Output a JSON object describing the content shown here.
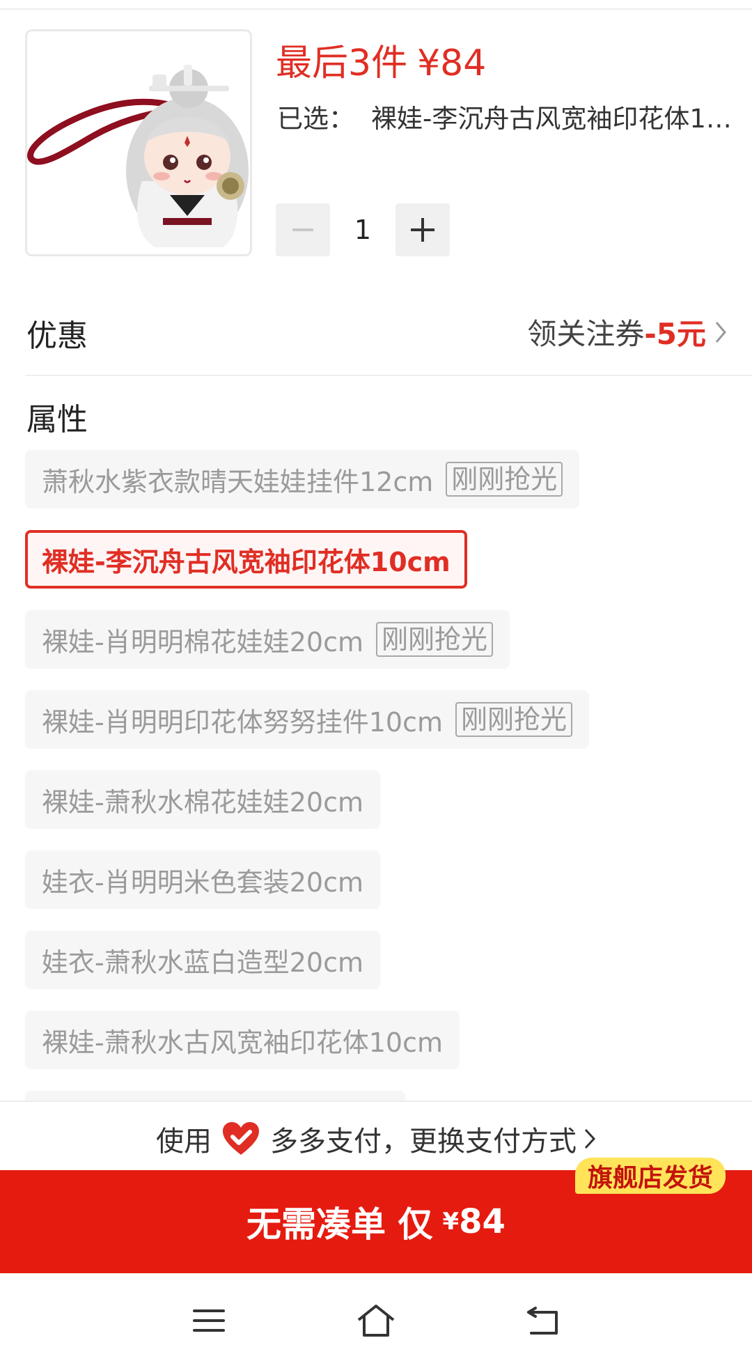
{
  "product": {
    "stock_text": "最后3件",
    "price_text": "¥84",
    "selected_label": "已选：",
    "selected_value": "裸娃-李沉舟古风宽袖印花体10cm",
    "quantity": "1"
  },
  "discount": {
    "label": "优惠",
    "coupon_text": "领关注券",
    "coupon_amount": "-5元"
  },
  "attributes": {
    "title": "属性",
    "options": [
      {
        "label": "萧秋水紫衣款晴天娃娃挂件12cm",
        "tag": "刚刚抢光",
        "state": "sold_out"
      },
      {
        "label": "裸娃-李沉舟古风宽袖印花体10cm",
        "tag": "",
        "state": "selected"
      },
      {
        "label": "裸娃-肖明明棉花娃娃20cm",
        "tag": "刚刚抢光",
        "state": "sold_out"
      },
      {
        "label": "裸娃-肖明明印花体努努挂件10cm",
        "tag": "刚刚抢光",
        "state": "sold_out"
      },
      {
        "label": "裸娃-萧秋水棉花娃娃20cm",
        "tag": "",
        "state": "available"
      },
      {
        "label": "娃衣-肖明明米色套装20cm",
        "tag": "",
        "state": "available"
      },
      {
        "label": "娃衣-萧秋水蓝白造型20cm",
        "tag": "",
        "state": "available"
      },
      {
        "label": "裸娃-萧秋水古风宽袖印花体10cm",
        "tag": "",
        "state": "available"
      }
    ]
  },
  "payment": {
    "prefix": "使用",
    "text": "多多支付，更换支付方式"
  },
  "buy_bar": {
    "label": "无需凑单 仅",
    "currency": "¥",
    "price": "84",
    "badge": "旗舰店发货"
  },
  "colors": {
    "accent_red": "#e02e24",
    "buy_bar": "#e51b10",
    "badge_yellow": "#ffe45a"
  },
  "icons": [
    "minus-icon",
    "plus-icon",
    "chevron-right-icon",
    "duoduo-pay-heart-icon",
    "menu-icon",
    "home-icon",
    "back-icon"
  ]
}
